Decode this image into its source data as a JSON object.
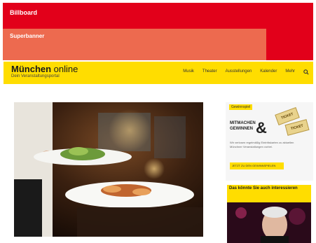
{
  "ads": {
    "billboard": "Billboard",
    "superbanner": "Superbanner"
  },
  "brand": {
    "name_bold": "München",
    "name_light": " online",
    "tagline": "Dein Veranstaltungsportal"
  },
  "nav": {
    "items": [
      "Musik",
      "Theater",
      "Ausstellungen",
      "Kalender",
      "Mehr"
    ]
  },
  "promo": {
    "badge": "Gewinnspiel",
    "title_lines": [
      "MITMACHEN",
      "GEWINNEN"
    ],
    "ampersand": "&",
    "text": "Wir verlosen regelmäßig Eintrittskarten zu aktuellen Münchner Veranstaltungen vorbei.",
    "button": "JETZT ZU DEN GEWINNSPIELEN",
    "ticket1": "TICKET",
    "ticket2": "TICKET"
  },
  "sidebar_headline": "Das könnte Sie auch interessieren",
  "colors": {
    "red": "#e2001a",
    "coral": "#ed6a4f",
    "yellow": "#ffdd00"
  }
}
